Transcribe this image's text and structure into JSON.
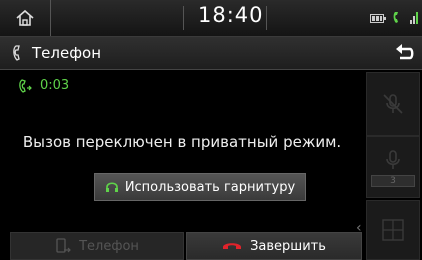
{
  "status": {
    "time": "18:40"
  },
  "header": {
    "title": "Телефон"
  },
  "call": {
    "duration": "0:03",
    "message": "Вызов переключен в приватный режим.",
    "headset_button": "Использовать гарнитуру",
    "phone_button": "Телефон",
    "end_button": "Завершить"
  },
  "side": {
    "volume_value": "3"
  },
  "icons": {
    "home": "home-icon",
    "battery": "battery-icon",
    "bluetooth_call": "bluetooth-call-icon",
    "signal": "signal-icon",
    "handset": "handset-icon",
    "back": "back-icon",
    "call_active": "call-active-icon",
    "headset": "headset-icon",
    "phone_transfer": "phone-transfer-icon",
    "hangup": "hangup-icon",
    "mic_mute": "mic-mute-icon",
    "mic_volume": "mic-volume-icon",
    "keypad": "keypad-icon"
  },
  "colors": {
    "accent_green": "#5fd34a",
    "hangup_red": "#e0232b"
  }
}
